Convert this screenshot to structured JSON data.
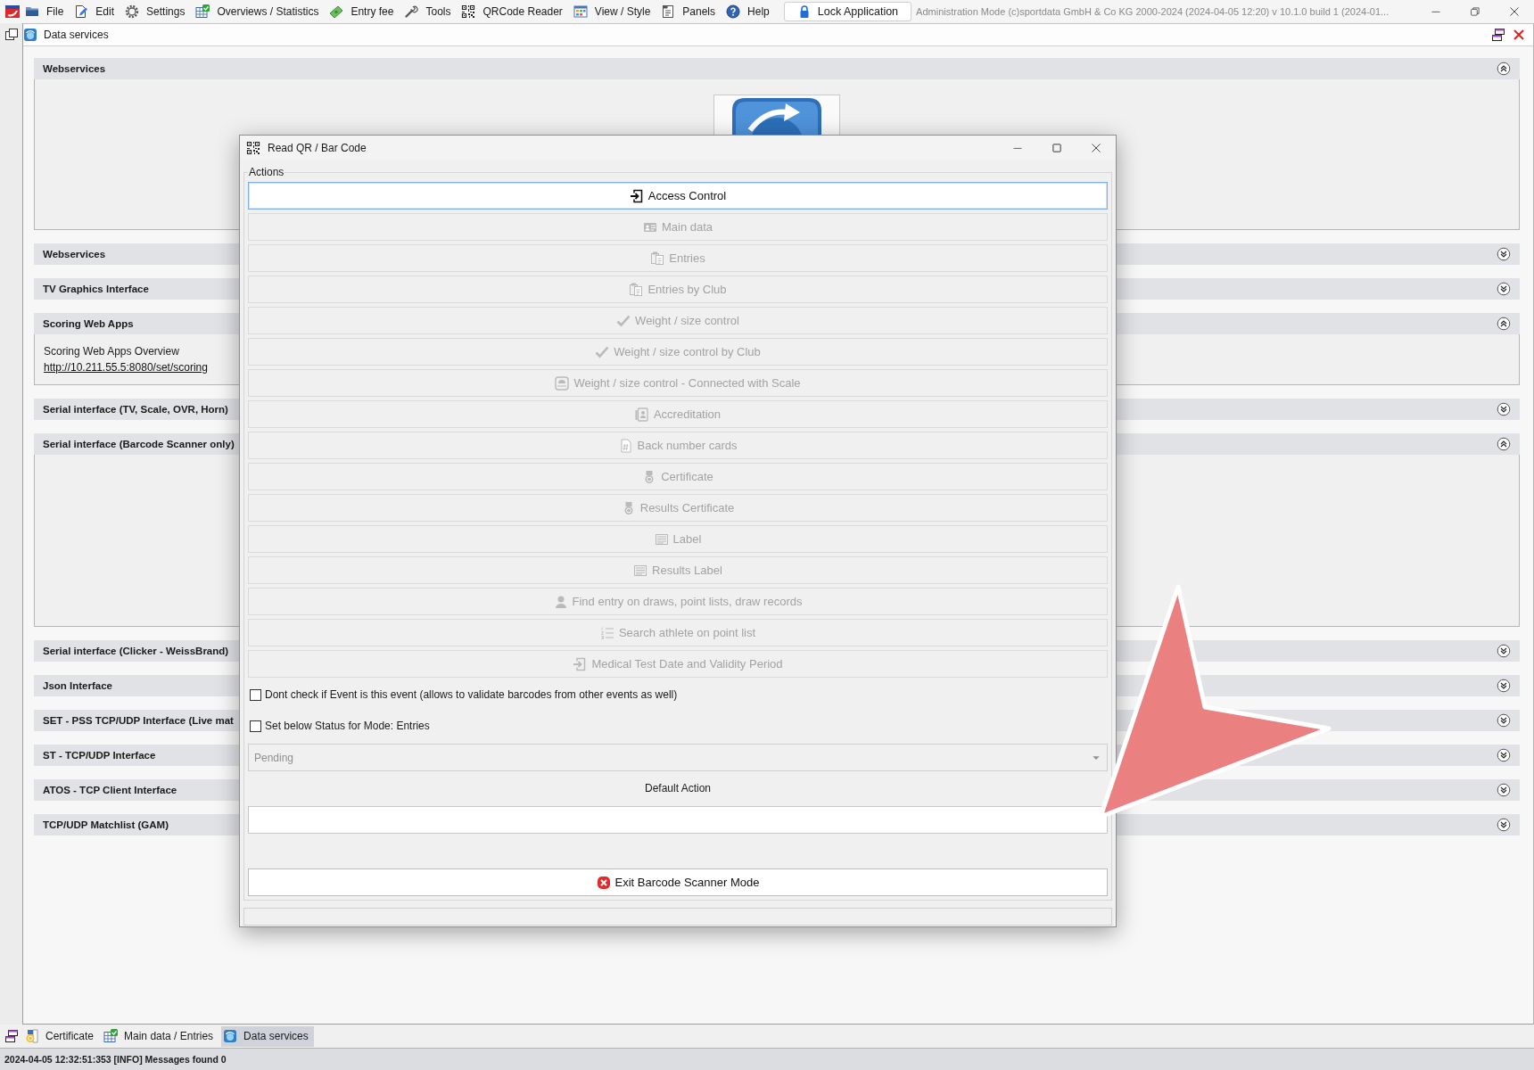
{
  "menu_bar": {
    "items": [
      {
        "label": "File"
      },
      {
        "label": "Edit"
      },
      {
        "label": "Settings"
      },
      {
        "label": "Overviews / Statistics"
      },
      {
        "label": "Entry fee"
      },
      {
        "label": "Tools"
      },
      {
        "label": "QRCode Reader"
      },
      {
        "label": "View / Style"
      },
      {
        "label": "Panels"
      },
      {
        "label": "Help"
      }
    ],
    "lock_button": {
      "label": "Lock Application"
    },
    "title": "Administration Mode (c)sportdata GmbH & Co KG 2000-2024 (2024-04-05 12:20) v 10.1.0 build 1 (2024-01..."
  },
  "panel": {
    "title": "Data services"
  },
  "sections": [
    {
      "title": "Webservices",
      "expanded": true,
      "content": {
        "kind": "tile"
      }
    },
    {
      "title": "Webservices",
      "expanded": false
    },
    {
      "title": "TV Graphics Interface",
      "expanded": false
    },
    {
      "title": "Scoring Web Apps",
      "expanded": true,
      "content": {
        "kind": "links",
        "text": "Scoring Web Apps Overview",
        "link": "http://10.211.55.5:8080/set/scoring"
      }
    },
    {
      "title": "Serial interface (TV, Scale, OVR, Horn)",
      "expanded": false
    },
    {
      "title": "Serial interface (Barcode Scanner only)",
      "expanded": true,
      "content": {
        "kind": "empty"
      }
    },
    {
      "title": "Serial interface (Clicker - WeissBrand)",
      "expanded": false
    },
    {
      "title": "Json Interface",
      "expanded": false
    },
    {
      "title": "SET - PSS TCP/UDP Interface (Live mat",
      "expanded": false
    },
    {
      "title": "ST - TCP/UDP Interface",
      "expanded": false
    },
    {
      "title": "ATOS - TCP Client Interface",
      "expanded": false
    },
    {
      "title": "TCP/UDP Matchlist (GAM)",
      "expanded": false
    }
  ],
  "dialog": {
    "title": "Read QR / Bar Code",
    "group_label": "Actions",
    "actions": [
      {
        "label": "Access Control",
        "disabled": false,
        "focused": true
      },
      {
        "label": "Main data",
        "disabled": true,
        "focused": false
      },
      {
        "label": "Entries",
        "disabled": true,
        "focused": false
      },
      {
        "label": "Entries by Club",
        "disabled": true,
        "focused": false
      },
      {
        "label": "Weight / size control",
        "disabled": true,
        "focused": false
      },
      {
        "label": "Weight / size control by Club",
        "disabled": true,
        "focused": false
      },
      {
        "label": "Weight / size control - Connected with Scale",
        "disabled": true,
        "focused": false
      },
      {
        "label": "Accreditation",
        "disabled": true,
        "focused": false
      },
      {
        "label": "Back number cards",
        "disabled": true,
        "focused": false
      },
      {
        "label": "Certificate",
        "disabled": true,
        "focused": false
      },
      {
        "label": "Results Certificate",
        "disabled": true,
        "focused": false
      },
      {
        "label": "Label",
        "disabled": true,
        "focused": false
      },
      {
        "label": "Results Label",
        "disabled": true,
        "focused": false
      },
      {
        "label": "Find entry on draws, point lists, draw records",
        "disabled": true,
        "focused": false
      },
      {
        "label": "Search athlete on point list",
        "disabled": true,
        "focused": false
      },
      {
        "label": "Medical Test Date and Validity Period",
        "disabled": true,
        "focused": false
      }
    ],
    "checkboxes": [
      {
        "label": "Dont check if Event is this event (allows to validate barcodes from other events as well)",
        "checked": false
      },
      {
        "label": "Set below Status for Mode: Entries",
        "checked": false
      }
    ],
    "status_dropdown": {
      "value": "Pending",
      "disabled": true
    },
    "default_action": {
      "label": "Default Action"
    },
    "exit_button": {
      "label": "Exit Barcode Scanner Mode"
    }
  },
  "window_tabs": [
    {
      "label": "Certificate",
      "selected": false
    },
    {
      "label": "Main data / Entries",
      "selected": false
    },
    {
      "label": "Data services",
      "selected": true
    }
  ],
  "status_bar": {
    "text": "2024-04-05 12:32:51:353 [INFO] Messages found 0"
  },
  "annotation": {
    "kind": "arrow"
  }
}
